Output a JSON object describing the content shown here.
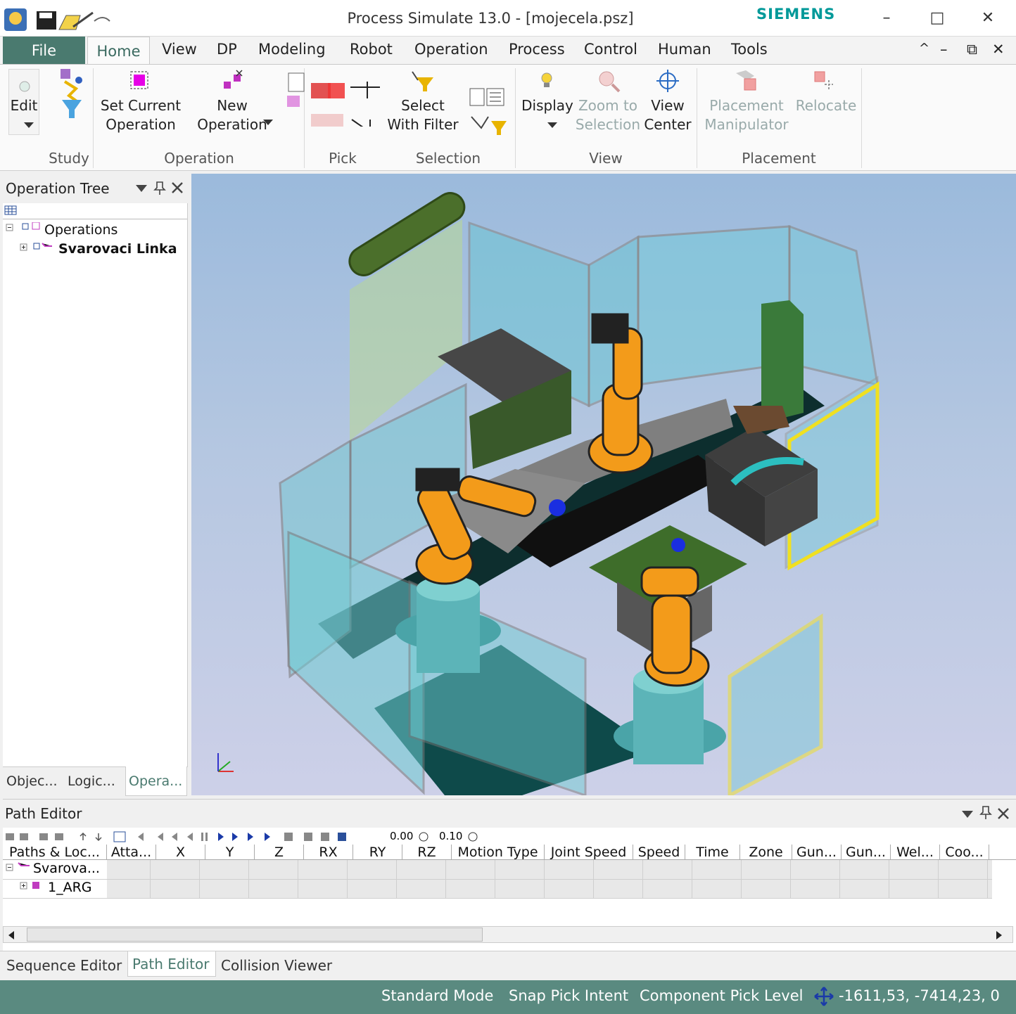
{
  "window": {
    "title": "Process Simulate 13.0 - [mojecela.psz]",
    "brand": "SIEMENS",
    "minimize": "–",
    "maximize": "□",
    "close": "✕"
  },
  "menu": {
    "file": "File",
    "tabs": [
      "Home",
      "View",
      "DP",
      "Modeling",
      "Robot",
      "Operation",
      "Process",
      "Control",
      "Human",
      "Tools"
    ],
    "right_controls": [
      "^",
      "–",
      "⧉",
      "✕"
    ]
  },
  "ribbon": {
    "edit": "Edit",
    "set_current_line1": "Set Current",
    "set_current_line2": "Operation",
    "new_line1": "New",
    "new_line2": "Operation",
    "select_line1": "Select",
    "select_line2": "With Filter",
    "display": "Display",
    "zoom_line1": "Zoom to",
    "zoom_line2": "Selection",
    "view_center_line1": "View",
    "view_center_line2": "Center",
    "placement_line1": "Placement",
    "placement_line2": "Manipulator",
    "relocate": "Relocate",
    "groups": {
      "study": "Study",
      "operation": "Operation",
      "pick": "Pick",
      "selection": "Selection",
      "view": "View",
      "placement": "Placement"
    }
  },
  "operation_tree": {
    "title": "Operation Tree",
    "root": "Operations",
    "child": "Svarovaci Linka",
    "tabs": [
      "Objec...",
      "Logic...",
      "Opera..."
    ]
  },
  "path_editor": {
    "title": "Path Editor",
    "time_value": "0.00",
    "step_value": "0.10",
    "columns": [
      "Paths & Loc...",
      "Atta...",
      "X",
      "Y",
      "Z",
      "RX",
      "RY",
      "RZ",
      "Motion Type",
      "Joint Speed",
      "Speed",
      "Time",
      "Zone",
      "Gun...",
      "Gun...",
      "Wel...",
      "Coo..."
    ],
    "rows": [
      "Svarova...",
      "1_ARG"
    ]
  },
  "bottom_tabs": [
    "Sequence Editor",
    "Path Editor",
    "Collision Viewer"
  ],
  "status": {
    "mode": "Standard Mode",
    "snap": "Snap Pick Intent",
    "pick_level": "Component Pick Level",
    "coords": "-1611,53, -7414,23, 0"
  },
  "colors": {
    "accent": "#4a7a6f",
    "statusbar": "#5a8a80",
    "brand": "#009999",
    "robot": "#f39b1a"
  }
}
